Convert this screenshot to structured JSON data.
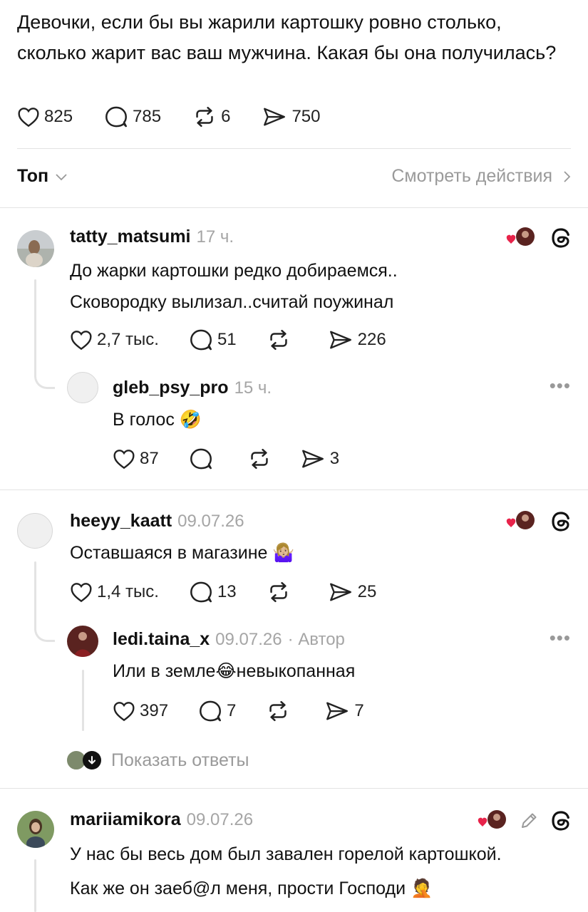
{
  "post": {
    "text": "Девочки, если бы вы жарили картошку ровно столько, сколько жарит вас ваш мужчина. Какая бы она получилась?",
    "likes": "825",
    "comments": "785",
    "reposts": "6",
    "shares": "750"
  },
  "sort": {
    "label": "Топ",
    "view_activity": "Смотреть действия"
  },
  "comments": [
    {
      "username": "tatty_matsumi",
      "time": "17 ч.",
      "text_line1": "До жарки картошки редко добираемся..",
      "text_line2": "Сковородку вылизал..считай поужинал",
      "likes": "2,7 тыс.",
      "replies": "51",
      "reposts": "",
      "shares": "226",
      "reply": {
        "username": "gleb_psy_pro",
        "time": "15 ч.",
        "text": "В голос 🤣",
        "likes": "87",
        "replies": "",
        "reposts": "",
        "shares": "3"
      }
    },
    {
      "username": "heeyy_kaatt",
      "time": "09.07.26",
      "text": "Оставшаяся в магазине 🤷🏼‍♀️",
      "likes": "1,4 тыс.",
      "replies": "13",
      "reposts": "",
      "shares": "25",
      "reply": {
        "username": "ledi.taina_x",
        "time": "09.07.26",
        "author_tag": "· Автор",
        "text": "Или в земле😂невыкопанная",
        "likes": "397",
        "replies": "7",
        "reposts": "",
        "shares": "7"
      },
      "show_replies": "Показать ответы"
    },
    {
      "username": "mariiamikora",
      "time": "09.07.26",
      "text_line1": "У нас бы весь дом был завален горелой картошкой.",
      "text_line2": "Как же он заеб@л меня, прости Господи 🤦"
    }
  ],
  "colors": {
    "heart": "#e8234a",
    "muted": "#9a9a9a",
    "divider": "#e3e3e3"
  },
  "icons": [
    "heart-icon",
    "comment-icon",
    "repost-icon",
    "share-icon",
    "threads-icon",
    "chevron-down-icon",
    "chevron-right-icon",
    "more-icon",
    "pencil-icon",
    "arrow-down-icon"
  ]
}
